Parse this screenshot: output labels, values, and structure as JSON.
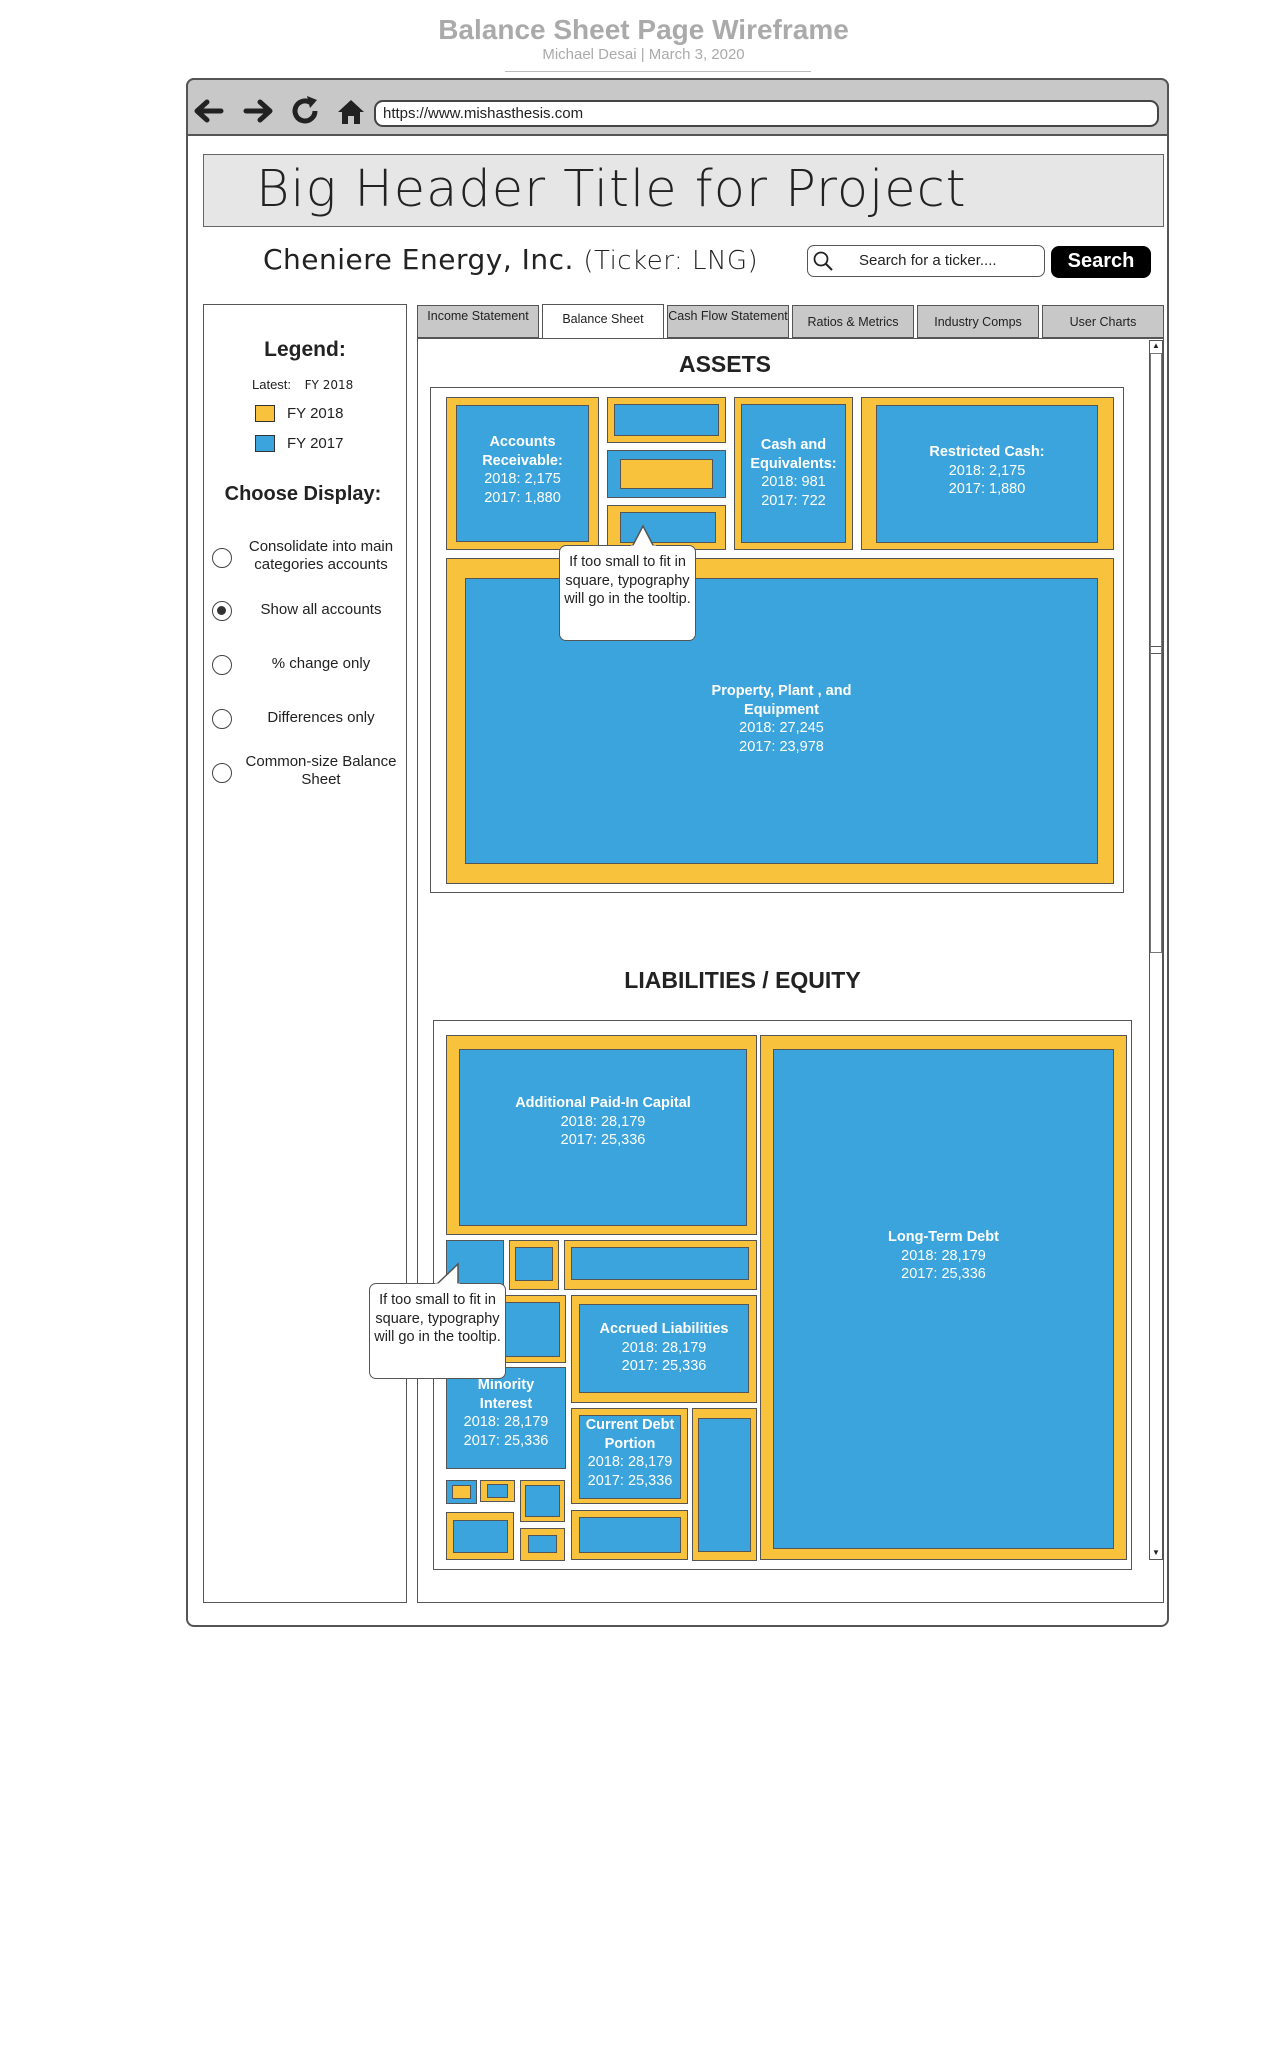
{
  "document": {
    "title": "Balance Sheet Page Wireframe",
    "author_date": "Michael Desai  |  March 3, 2020"
  },
  "browser": {
    "url": "https://www.mishasthesis.com",
    "nav_icons": [
      "back-arrow-icon",
      "forward-arrow-icon",
      "reload-icon",
      "home-icon"
    ]
  },
  "header": {
    "title": "Big Header Title for Project",
    "company": "Cheniere Energy, Inc.",
    "ticker": "(Ticker: LNG)",
    "search_placeholder": "Search for a ticker....",
    "search_button": "Search"
  },
  "sidebar": {
    "legend_title": "Legend:",
    "latest_label": "Latest:",
    "latest_value": "FY 2018",
    "legend_items": [
      {
        "label": "FY 2018",
        "color": "#f9c23c"
      },
      {
        "label": "FY 2017",
        "color": "#3ca4dc"
      }
    ],
    "choose_title": "Choose Display:",
    "options": [
      {
        "label": "Consolidate into main categories accounts",
        "selected": false
      },
      {
        "label": "Show all accounts",
        "selected": true
      },
      {
        "label": "% change only",
        "selected": false
      },
      {
        "label": "Differences only",
        "selected": false
      },
      {
        "label": "Common-size Balance Sheet",
        "selected": false
      }
    ]
  },
  "tabs": [
    {
      "label": "Income Statement",
      "active": false
    },
    {
      "label": "Balance Sheet",
      "active": true
    },
    {
      "label": "Cash Flow Statement",
      "active": false
    },
    {
      "label": "Ratios & Metrics",
      "active": false
    },
    {
      "label": "Industry Comps",
      "active": false
    },
    {
      "label": "User Charts",
      "active": false
    }
  ],
  "assets": {
    "title": "ASSETS",
    "accounts_receivable": {
      "name": "Accounts Receivable:",
      "y2018": "2018: 2,175",
      "y2017": "2017: 1,880"
    },
    "cash": {
      "name": "Cash and Equivalents:",
      "y2018": "2018: 981",
      "y2017": "2017: 722"
    },
    "restricted_cash": {
      "name": "Restricted Cash:",
      "y2018": "2018: 2,175",
      "y2017": "2017: 1,880"
    },
    "ppe": {
      "name": "Property, Plant , and Equipment",
      "y2018": "2018: 27,245",
      "y2017": "2017: 23,978"
    },
    "tooltip": "If too small to fit in square, typography will go in the tooltip."
  },
  "liabilities": {
    "title": "LIABILITIES / EQUITY",
    "apic": {
      "name": "Additional Paid-In Capital",
      "y2018": "2018: 28,179",
      "y2017": "2017: 25,336"
    },
    "ltd": {
      "name": "Long-Term Debt",
      "y2018": "2018: 28,179",
      "y2017": "2017: 25,336"
    },
    "accrued": {
      "name": "Accrued Liabilities",
      "y2018": "2018: 28,179",
      "y2017": "2017: 25,336"
    },
    "minority": {
      "name": "Minority Interest",
      "y2018": "2018: 28,179",
      "y2017": "2017: 25,336"
    },
    "current_debt": {
      "name": "Current Debt Portion",
      "y2018": "2018: 28,179",
      "y2017": "2017: 25,336"
    },
    "tooltip": "If too small to fit in square, typography will go in the tooltip."
  }
}
